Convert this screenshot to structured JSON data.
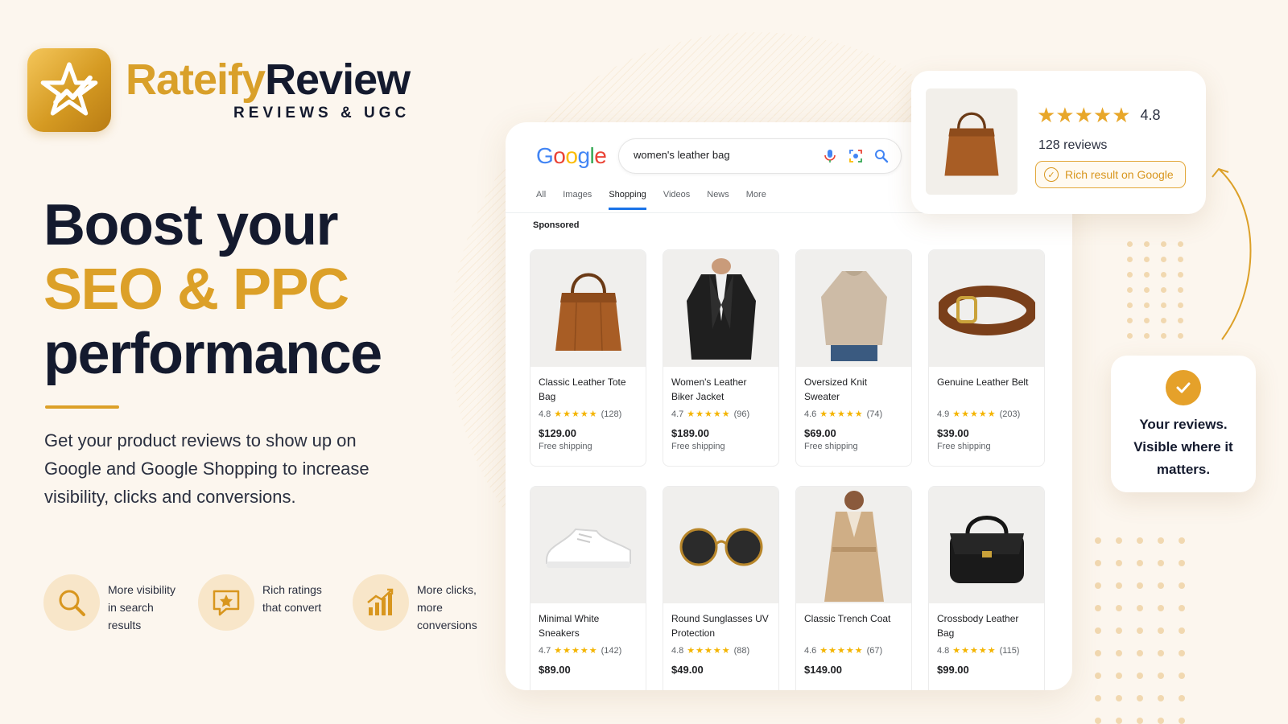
{
  "brand": {
    "name_part1": "Rateify",
    "name_part2": "Review",
    "tagline": "REVIEWS & UGC",
    "accent_color": "#dca028",
    "dark_color": "#141a2e"
  },
  "hero": {
    "line1": "Boost your",
    "line2": "SEO & PPC",
    "line3": "performance",
    "subtitle": "Get your product reviews to show up on Google and Google Shopping to increase visibility, clicks and conversions."
  },
  "features": [
    {
      "icon": "magnifier-icon",
      "text": "More visibility in search results"
    },
    {
      "icon": "star-chat-icon",
      "text": "Rich ratings that convert"
    },
    {
      "icon": "growth-chart-icon",
      "text": "More clicks, more conversions"
    }
  ],
  "google": {
    "logo_letters": [
      "G",
      "o",
      "o",
      "g",
      "l",
      "e"
    ],
    "search_query": "women's leather bag",
    "tabs": [
      "All",
      "Images",
      "Shopping",
      "Videos",
      "News",
      "More"
    ],
    "active_tab": "Shopping",
    "sponsored_label": "Sponsored",
    "products": [
      {
        "name": "Classic Leather Tote Bag",
        "rating": "4.8",
        "stars": "★★★★★",
        "reviews": "(128)",
        "price": "$129.00",
        "shipping": "Free shipping",
        "icon": "tote-bag-icon"
      },
      {
        "name": "Women's Leather Biker Jacket",
        "rating": "4.7",
        "stars": "★★★★★",
        "reviews": "(96)",
        "price": "$189.00",
        "shipping": "Free shipping",
        "icon": "jacket-icon"
      },
      {
        "name": "Oversized Knit Sweater",
        "rating": "4.6",
        "stars": "★★★★★",
        "reviews": "(74)",
        "price": "$69.00",
        "shipping": "Free shipping",
        "icon": "sweater-icon"
      },
      {
        "name": "Genuine Leather Belt",
        "rating": "4.9",
        "stars": "★★★★★",
        "reviews": "(203)",
        "price": "$39.00",
        "shipping": "Free shipping",
        "icon": "belt-icon"
      },
      {
        "name": "Minimal White Sneakers",
        "rating": "4.7",
        "stars": "★★★★★",
        "reviews": "(142)",
        "price": "$89.00",
        "shipping": "",
        "icon": "sneaker-icon"
      },
      {
        "name": "Round Sunglasses UV Protection",
        "rating": "4.8",
        "stars": "★★★★★",
        "reviews": "(88)",
        "price": "$49.00",
        "shipping": "",
        "icon": "sunglasses-icon"
      },
      {
        "name": "Classic Trench Coat",
        "rating": "4.6",
        "stars": "★★★★★",
        "reviews": "(67)",
        "price": "$149.00",
        "shipping": "",
        "icon": "trench-coat-icon"
      },
      {
        "name": "Crossbody Leather Bag",
        "rating": "4.8",
        "stars": "★★★★★",
        "reviews": "(115)",
        "price": "$99.00",
        "shipping": "",
        "icon": "crossbody-bag-icon"
      }
    ]
  },
  "rich_result": {
    "stars": "★★★★★",
    "rating": "4.8",
    "reviews": "128 reviews",
    "badge": "Rich result on Google"
  },
  "visible_card": {
    "text": "Your reviews. Visible where it matters."
  }
}
